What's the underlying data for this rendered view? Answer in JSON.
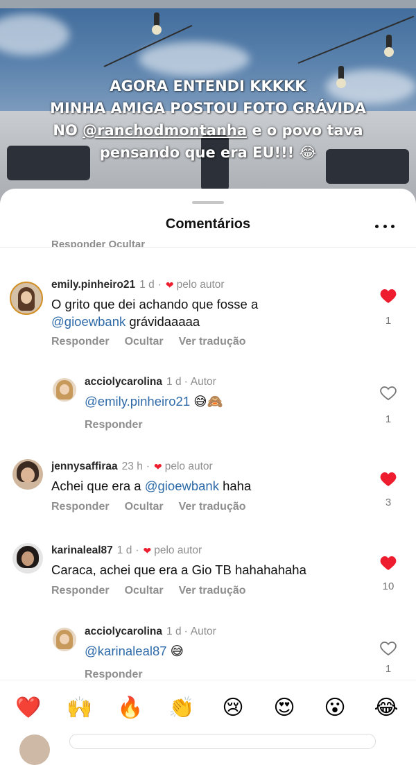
{
  "story": {
    "line1": "AGORA ENTENDI KKKKK",
    "line2": "MINHA AMIGA POSTOU FOTO GRÁVIDA",
    "line3_prefix": "NO ",
    "line3_mention": "@ranchodmontanha",
    "line3_suffix": " e o povo tava",
    "line4": "pensando que era EU!!! 😂"
  },
  "sheet": {
    "title": "Comentários",
    "cut_text": "Responder     Ocultar"
  },
  "comments": [
    {
      "username": "emily.pinheiro21",
      "time": "1 d",
      "author_like": "pelo autor",
      "text_line1": "O grito que dei achando que fosse a",
      "mention": "@gioewbank",
      "text_after": " grávidaaaaa",
      "actions": [
        "Responder",
        "Ocultar",
        "Ver tradução"
      ],
      "liked": true,
      "likes": "1"
    },
    {
      "username": "acciolycarolina",
      "time": "1 d",
      "badge": "Autor",
      "mention": "@emily.pinheiro21",
      "text_after": " 😅🙈",
      "actions": [
        "Responder"
      ],
      "liked": false,
      "likes": "1"
    },
    {
      "username": "jennysaffiraa",
      "time": "23 h",
      "author_like": "pelo autor",
      "text_before": "Achei que era a ",
      "mention": "@gioewbank",
      "text_after": " haha",
      "actions": [
        "Responder",
        "Ocultar",
        "Ver tradução"
      ],
      "liked": true,
      "likes": "3"
    },
    {
      "username": "karinaleal87",
      "time": "1 d",
      "author_like": "pelo autor",
      "text": "Caraca, achei que era a Gio TB hahahahaha",
      "actions": [
        "Responder",
        "Ocultar",
        "Ver tradução"
      ],
      "liked": true,
      "likes": "10"
    },
    {
      "username": "acciolycarolina",
      "time": "1 d",
      "badge": "Autor",
      "mention": "@karinaleal87",
      "text_after": " 😅",
      "actions": [
        "Responder"
      ],
      "liked": false,
      "likes": "1"
    }
  ],
  "separator": "·",
  "emoji_bar": [
    "❤️",
    "🙌",
    "🔥",
    "👏",
    "😢",
    "😍",
    "😮",
    "😂"
  ],
  "colors": {
    "like_red": "#ed1c2e",
    "link_blue": "#2e6aa8",
    "muted_gray": "#8e8e8e"
  }
}
